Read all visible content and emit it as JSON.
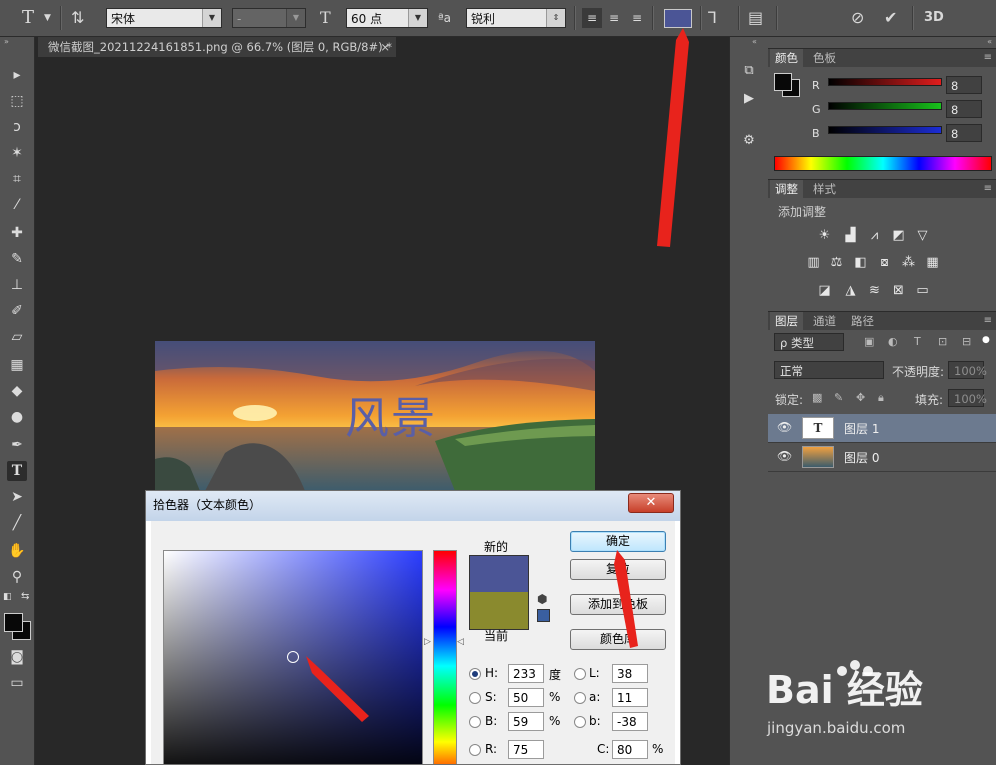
{
  "options_bar": {
    "tool_glyph": "T",
    "font_family": "宋体",
    "font_style": "-",
    "font_size": "60 点",
    "aa_label": "ªa",
    "antialias": "锐利",
    "text_color": "#4b5596"
  },
  "document_tab": {
    "title": "微信截图_20211224161851.png @ 66.7% (图层 0, RGB/8#) *",
    "close": "×"
  },
  "canvas_image": {
    "overlay_text": "风景"
  },
  "color_panel": {
    "tabs": [
      "颜色",
      "色板"
    ],
    "channels": [
      {
        "label": "R",
        "value": "8",
        "color": "#e11d1d"
      },
      {
        "label": "G",
        "value": "8",
        "color": "#18c21b"
      },
      {
        "label": "B",
        "value": "8",
        "color": "#1c2dd6"
      }
    ]
  },
  "adjustments_panel": {
    "tabs": [
      "调整",
      "样式"
    ],
    "title": "添加调整"
  },
  "layers_panel": {
    "tabs": [
      "图层",
      "通道",
      "路径"
    ],
    "filter_type": "ρ 类型",
    "blend_mode": "正常",
    "opacity_label": "不透明度:",
    "opacity_value": "100%",
    "lock_label": "锁定:",
    "fill_label": "填充:",
    "fill_value": "100%",
    "layers": [
      {
        "name": "图层 1",
        "kind": "text",
        "selected": true
      },
      {
        "name": "图层 0",
        "kind": "image",
        "selected": false
      }
    ]
  },
  "color_picker": {
    "title": "拾色器（文本颜色）",
    "close": "✕",
    "new_label": "新的",
    "current_label": "当前",
    "new_color": "#4b5596",
    "current_color": "#8a8a2e",
    "buttons": {
      "ok": "确定",
      "reset": "复位",
      "add_to_swatches": "添加到色板",
      "color_libraries": "颜色库"
    },
    "hsb": [
      {
        "label": "H:",
        "value": "233",
        "unit": "度",
        "checked": true
      },
      {
        "label": "S:",
        "value": "50",
        "unit": "%",
        "checked": false
      },
      {
        "label": "B:",
        "value": "59",
        "unit": "%",
        "checked": false
      }
    ],
    "lab": [
      {
        "label": "L:",
        "value": "38"
      },
      {
        "label": "a:",
        "value": "11"
      },
      {
        "label": "b:",
        "value": "-38"
      }
    ],
    "r": {
      "label": "R:",
      "value": "75"
    },
    "c": {
      "label": "C:",
      "value": "80",
      "unit": "%"
    }
  },
  "watermark": {
    "brand": "Bai 经验",
    "url": "jingyan.baidu.com"
  }
}
